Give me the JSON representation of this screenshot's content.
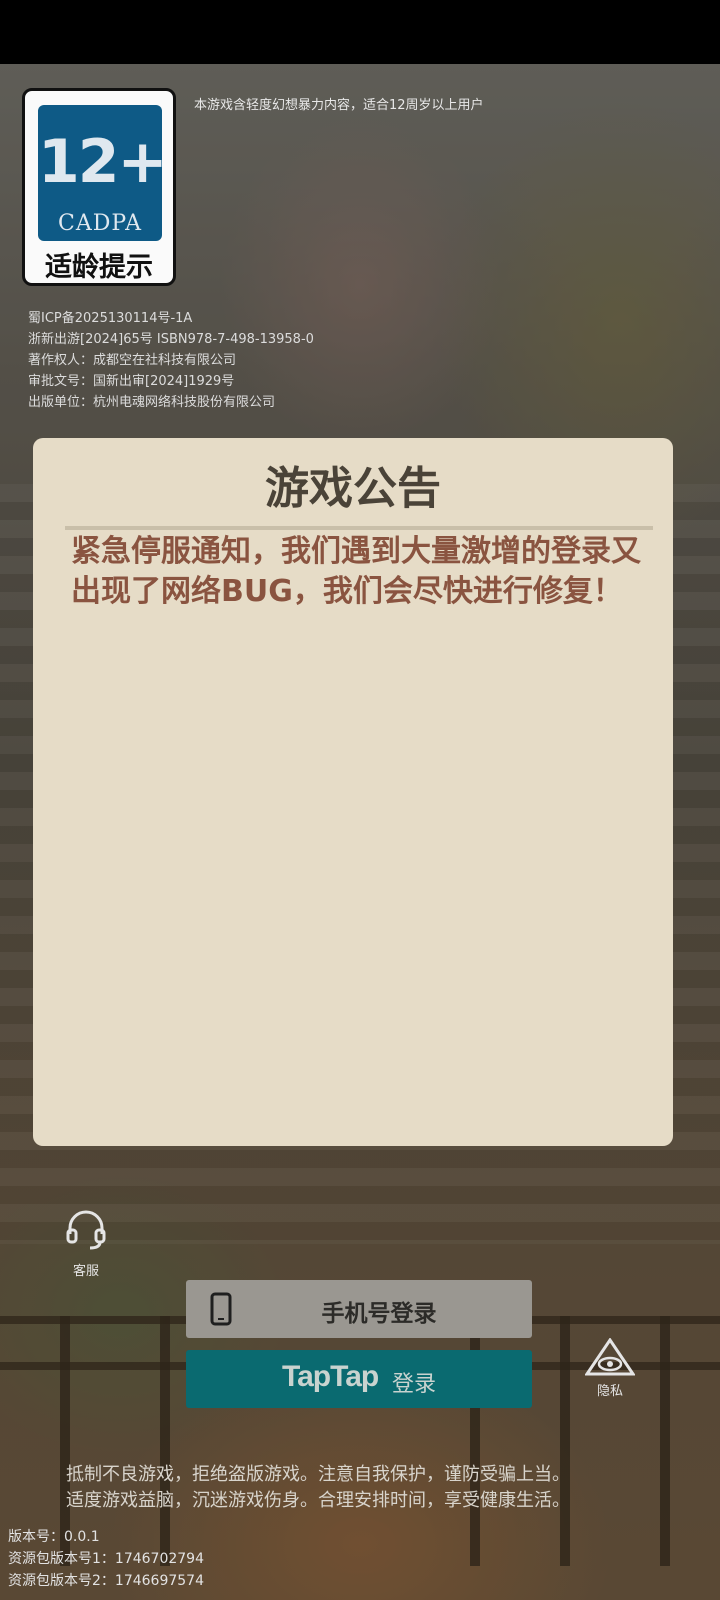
{
  "header": {
    "age_badge": {
      "age": "12+",
      "org": "CADPA",
      "label": "适龄提示"
    },
    "content_notice": "本游戏含轻度幻想暴力内容，适合12周岁以上用户",
    "license_lines": [
      "蜀ICP备2025130114号-1A",
      "浙新出游[2024]65号 ISBN978-7-498-13958-0",
      "著作权人：成都空在社科技有限公司",
      "审批文号：国新出审[2024]1929号",
      "出版单位：杭州电魂网络科技股份有限公司"
    ]
  },
  "announcement": {
    "title": "游戏公告",
    "body": "紧急停服通知，我们遇到大量激增的登录又出现了网络BUG，我们会尽快进行修复！"
  },
  "actions": {
    "service_label": "客服",
    "privacy_label": "隐私",
    "phone_login_label": "手机号登录",
    "taptap_brand": "TapTap",
    "taptap_login_label": "登录"
  },
  "footer": {
    "health_lines": [
      "抵制不良游戏，拒绝盗版游戏。注意自我保护，谨防受骗上当。",
      "适度游戏益脑，沉迷游戏伤身。合理安排时间，享受健康生活。"
    ],
    "version_lines": [
      "版本号：0.0.1",
      "资源包版本号1：1746702794",
      "资源包版本号2：1746697574"
    ]
  },
  "colors": {
    "modal_bg": "#e6dcc7",
    "modal_text": "#8a5440",
    "taptap_teal": "#0a6a70",
    "badge_blue": "#0e5a86"
  }
}
